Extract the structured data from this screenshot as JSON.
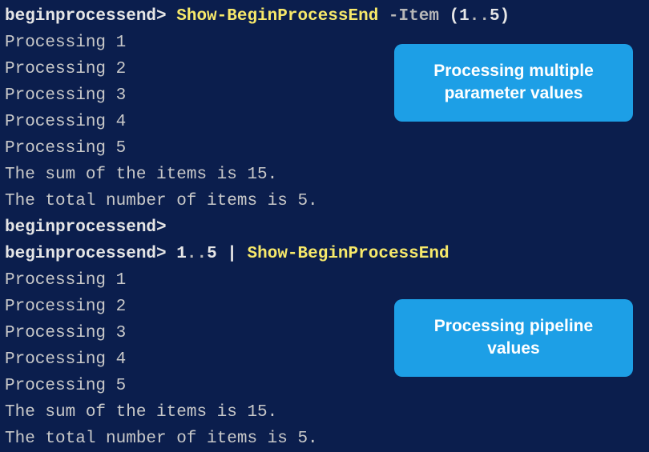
{
  "prompt": "beginprocessend>",
  "block1": {
    "cmdlet": "Show-BeginProcessEnd",
    "param": "-Item",
    "lparen": "(",
    "range_start": "1",
    "range_op": "..",
    "range_end": "5",
    "rparen": ")",
    "out1": "Processing 1",
    "out2": "Processing 2",
    "out3": "Processing 3",
    "out4": "Processing 4",
    "out5": "Processing 5",
    "sum": "The sum of the items is 15.",
    "total": "The total number of items is 5."
  },
  "block2": {
    "range_start": "1",
    "range_op": "..",
    "range_end": "5",
    "pipe": "|",
    "cmdlet": "Show-BeginProcessEnd",
    "out1": "Processing 1",
    "out2": "Processing 2",
    "out3": "Processing 3",
    "out4": "Processing 4",
    "out5": "Processing 5",
    "sum": "The sum of the items is 15.",
    "total": "The total number of items is 5."
  },
  "callout1_line1": "Processing multiple",
  "callout1_line2": "parameter values",
  "callout2_line1": "Processing pipeline",
  "callout2_line2": "values"
}
